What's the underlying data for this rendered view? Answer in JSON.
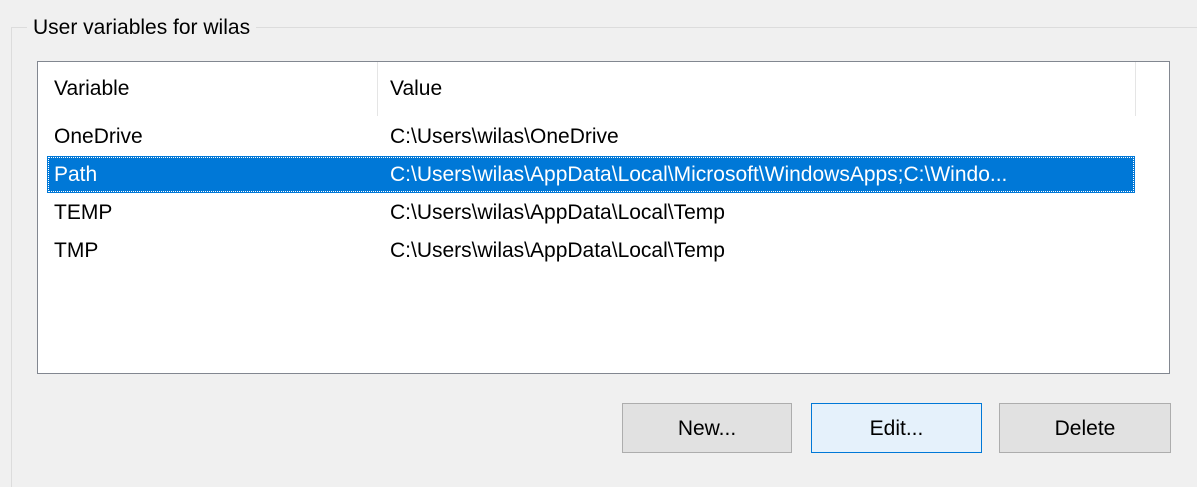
{
  "group": {
    "title": "User variables for wilas"
  },
  "list": {
    "columns": [
      "Variable",
      "Value"
    ],
    "rows": [
      {
        "variable": "OneDrive",
        "value": "C:\\Users\\wilas\\OneDrive",
        "selected": false
      },
      {
        "variable": "Path",
        "value": "C:\\Users\\wilas\\AppData\\Local\\Microsoft\\WindowsApps;C:\\Windo...",
        "selected": true
      },
      {
        "variable": "TEMP",
        "value": "C:\\Users\\wilas\\AppData\\Local\\Temp",
        "selected": false
      },
      {
        "variable": "TMP",
        "value": "C:\\Users\\wilas\\AppData\\Local\\Temp",
        "selected": false
      }
    ]
  },
  "buttons": {
    "new_label": "New...",
    "edit_label": "Edit...",
    "delete_label": "Delete"
  },
  "colors": {
    "selection": "#0078d7",
    "focus_button_bg": "#e5f1fb",
    "button_bg": "#e1e1e1"
  }
}
